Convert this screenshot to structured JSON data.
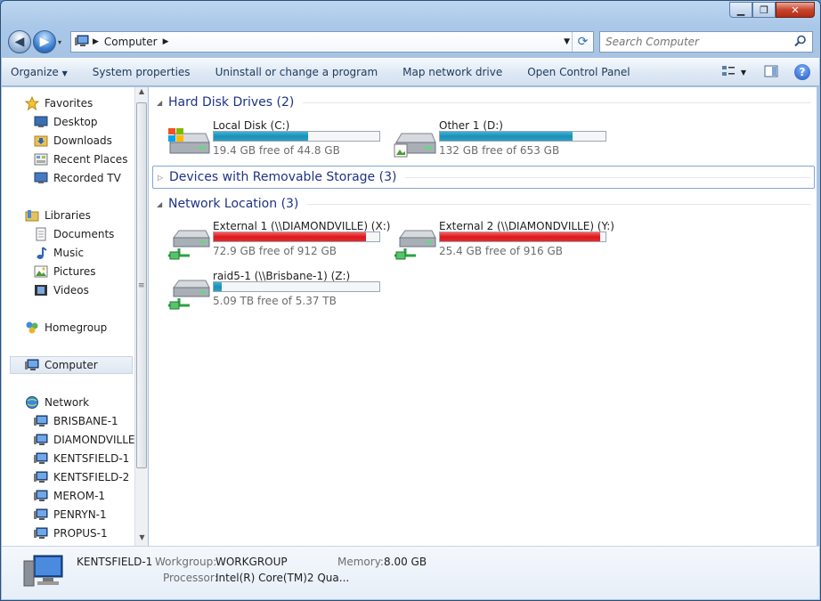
{
  "window": {
    "min_label": "▁",
    "max_label": "❐",
    "close_label": "✕"
  },
  "nav": {
    "back_label": "◀",
    "forward_label": "▶",
    "recent_label": "▾",
    "breadcrumb": [
      "Computer"
    ],
    "refresh_label": "⟳",
    "search_placeholder": "Search Computer"
  },
  "toolbar": {
    "organize": "Organize",
    "system_properties": "System properties",
    "uninstall": "Uninstall or change a program",
    "map_drive": "Map network drive",
    "control_panel": "Open Control Panel",
    "help_label": "?"
  },
  "sidebar": {
    "favorites": "Favorites",
    "favorites_items": [
      "Desktop",
      "Downloads",
      "Recent Places",
      "Recorded TV"
    ],
    "libraries": "Libraries",
    "libraries_items": [
      "Documents",
      "Music",
      "Pictures",
      "Videos"
    ],
    "homegroup": "Homegroup",
    "computer": "Computer",
    "network": "Network",
    "network_items": [
      "BRISBANE-1",
      "DIAMONDVILLE",
      "KENTSFIELD-1",
      "KENTSFIELD-2",
      "MEROM-1",
      "PENRYN-1",
      "PROPUS-1"
    ]
  },
  "groups": {
    "hard_disks": "Hard Disk Drives (2)",
    "removable": "Devices with Removable Storage (3)",
    "network": "Network Location (3)"
  },
  "drives": {
    "c": {
      "name": "Local Disk (C:)",
      "free": "19.4 GB free of 44.8 GB",
      "used_fraction": 0.57
    },
    "d": {
      "name": "Other 1 (D:)",
      "free": "132 GB free of 653 GB",
      "used_fraction": 0.8
    },
    "x": {
      "name": "External 1 (\\\\DIAMONDVILLE) (X:)",
      "free": "72.9 GB free of 912 GB",
      "used_fraction": 0.92
    },
    "y": {
      "name": "External 2 (\\\\DIAMONDVILLE) (Y:)",
      "free": "25.4 GB free of 916 GB",
      "used_fraction": 0.97
    },
    "z": {
      "name": "raid5-1 (\\\\Brisbane-1) (Z:)",
      "free": "5.09 TB free of 5.37 TB",
      "used_fraction": 0.05
    }
  },
  "details": {
    "computer_name": "KENTSFIELD-1",
    "workgroup_label": "Workgroup:",
    "workgroup": "WORKGROUP",
    "memory_label": "Memory:",
    "memory": "8.00 GB",
    "processor_label": "Processor:",
    "processor": "Intel(R) Core(TM)2 Qua..."
  },
  "colors": {
    "accent_text": "#1e3287",
    "bar_ok": "#1c8fb6",
    "bar_full": "#d9191f"
  }
}
